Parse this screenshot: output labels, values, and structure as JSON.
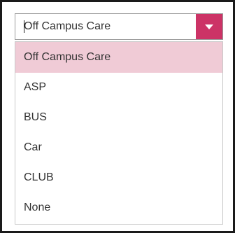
{
  "select": {
    "value": "Off Campus Care",
    "arrow_icon": "triangle-down-icon",
    "accent_color": "#cc3366",
    "highlight_color": "#f0cbd6"
  },
  "options": [
    {
      "label": "Off Campus Care",
      "selected": true
    },
    {
      "label": "ASP",
      "selected": false
    },
    {
      "label": "BUS",
      "selected": false
    },
    {
      "label": "Car",
      "selected": false
    },
    {
      "label": "CLUB",
      "selected": false
    },
    {
      "label": "None",
      "selected": false
    }
  ]
}
